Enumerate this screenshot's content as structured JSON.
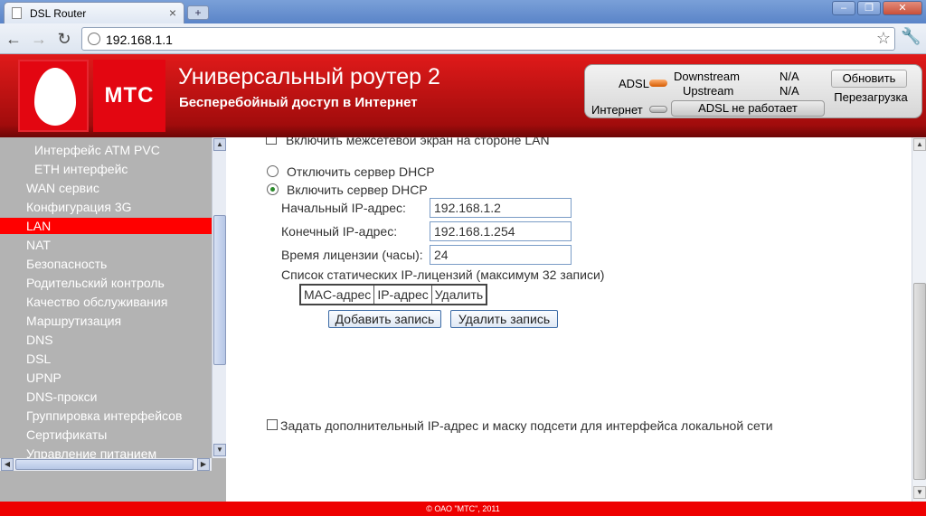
{
  "browser": {
    "tab_title": "DSL Router",
    "tab_close": "×",
    "new_tab": "+",
    "url": "192.168.1.1",
    "window_controls": [
      "‒",
      "❐",
      "✕"
    ]
  },
  "header": {
    "brand": "МТС",
    "title": "Универсальный роутер 2",
    "subtitle": "Бесперебойный доступ в Интернет",
    "status": {
      "adsl_label": "ADSL",
      "downstream_label": "Downstream",
      "upstream_label": "Upstream",
      "downstream_value": "N/A",
      "upstream_value": "N/A",
      "internet_label": "Интернет",
      "adsl_message": "ADSL не работает",
      "refresh_button": "Обновить",
      "reboot_button": "Перезагрузка"
    }
  },
  "sidebar": {
    "items": [
      {
        "label": "Интерфейс ATM PVC",
        "level": "sub"
      },
      {
        "label": "ETH интерфейс",
        "level": "sub"
      },
      {
        "label": "WAN сервис",
        "level": "top"
      },
      {
        "label": "Конфигурация 3G",
        "level": "top"
      },
      {
        "label": "LAN",
        "level": "top",
        "active": true
      },
      {
        "label": "NAT",
        "level": "top"
      },
      {
        "label": "Безопасность",
        "level": "top"
      },
      {
        "label": "Родительский контроль",
        "level": "top"
      },
      {
        "label": "Качество обслуживания",
        "level": "top"
      },
      {
        "label": "Маршрутизация",
        "level": "top"
      },
      {
        "label": "DNS",
        "level": "top"
      },
      {
        "label": "DSL",
        "level": "top"
      },
      {
        "label": "UPNP",
        "level": "top"
      },
      {
        "label": "DNS-прокси",
        "level": "top"
      },
      {
        "label": "Группировка интерфейсов",
        "level": "top"
      },
      {
        "label": "Сертификаты",
        "level": "top"
      },
      {
        "label": "Управление питанием",
        "level": "top"
      }
    ]
  },
  "main": {
    "firewall_lan_label": "Включить межсетевой экран на стороне LAN",
    "dhcp_off_label": "Отключить сервер DHCP",
    "dhcp_on_label": "Включить сервер DHCP",
    "start_ip_label": "Начальный IP-адрес:",
    "start_ip_value": "192.168.1.2",
    "end_ip_label": "Конечный IP-адрес:",
    "end_ip_value": "192.168.1.254",
    "lease_label": "Время лицензии (часы):",
    "lease_value": "24",
    "static_list_label": "Список статических IP-лицензий (максимум 32 записи)",
    "table_headers": [
      "MAC-адрес",
      "IP-адрес",
      "Удалить"
    ],
    "add_button": "Добавить запись",
    "delete_button": "Удалить запись",
    "extra_ip_label": "Задать дополнительный IP-адрес и маску подсети для интерфейса локальной сети"
  },
  "footer": {
    "copyright": "© ОАО \"МТС\", 2011"
  }
}
